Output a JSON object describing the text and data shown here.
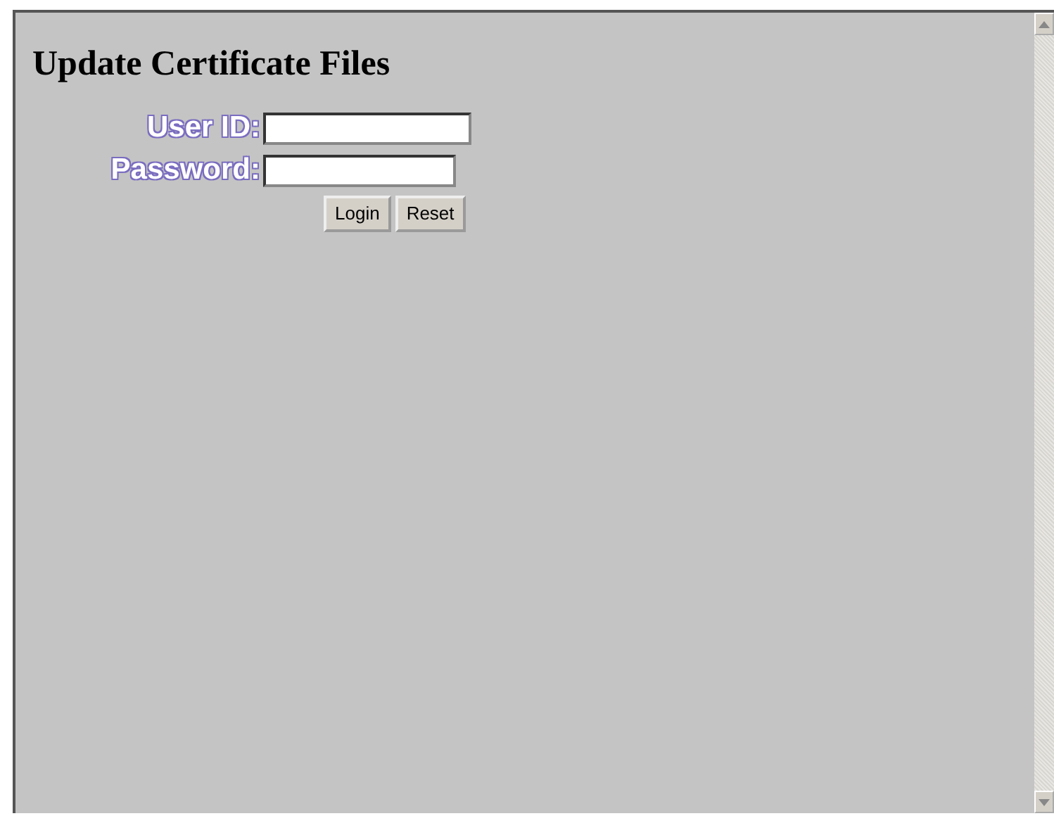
{
  "heading": "Update Certificate Files",
  "fields": [
    {
      "label": "User ID:"
    },
    {
      "label": "Password:"
    }
  ],
  "buttons": [
    "Login",
    "Reset"
  ]
}
